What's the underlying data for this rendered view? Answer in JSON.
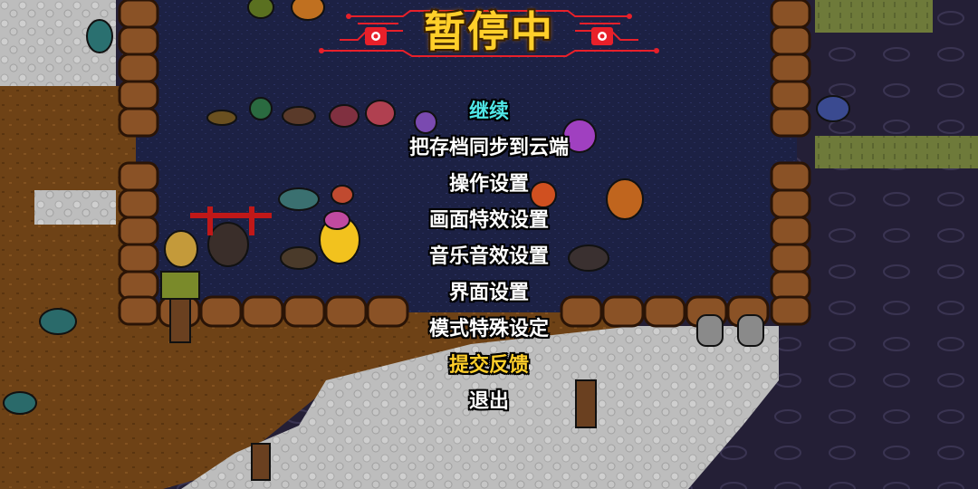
{
  "pause_title": "暂停中",
  "menu": {
    "items": [
      {
        "id": "continue",
        "label": "继续",
        "color": "#4fe6e6"
      },
      {
        "id": "cloud-sync",
        "label": "把存档同步到云端",
        "color": "#ffffff"
      },
      {
        "id": "controls",
        "label": "操作设置",
        "color": "#ffffff"
      },
      {
        "id": "graphics",
        "label": "画面特效设置",
        "color": "#ffffff"
      },
      {
        "id": "audio",
        "label": "音乐音效设置",
        "color": "#ffffff"
      },
      {
        "id": "interface",
        "label": "界面设置",
        "color": "#ffffff"
      },
      {
        "id": "mode",
        "label": "模式特殊设定",
        "color": "#ffffff"
      },
      {
        "id": "feedback",
        "label": "提交反馈",
        "color": "#ffcf2a"
      },
      {
        "id": "quit",
        "label": "退出",
        "color": "#ffffff"
      }
    ]
  },
  "colors": {
    "banner_red": "#e8202a",
    "title_gold": "#ffcf2a",
    "selected_cyan": "#4fe6e6",
    "dirt": "#7a4a18",
    "snow": "#c9c9c9",
    "pen_floor": "#1a1f3c"
  }
}
